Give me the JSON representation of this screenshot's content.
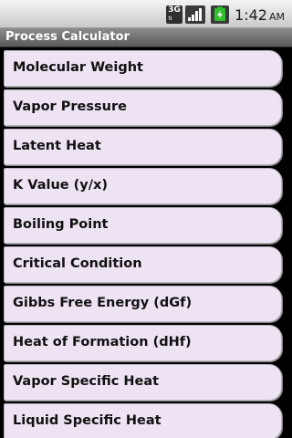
{
  "status_bar": {
    "network_type": "3G",
    "time": "1:42",
    "ampm": "AM",
    "icons": [
      "3g-icon",
      "signal-strength-icon",
      "battery-charging-icon"
    ],
    "battery_color": "#2fbf2f"
  },
  "app": {
    "title": "Process Calculator"
  },
  "menu": {
    "item_background": "#eee3f3",
    "items": [
      {
        "label": "Molecular Weight"
      },
      {
        "label": "Vapor Pressure"
      },
      {
        "label": "Latent Heat"
      },
      {
        "label": "K Value (y/x)"
      },
      {
        "label": "Boiling Point"
      },
      {
        "label": "Critical Condition"
      },
      {
        "label": "Gibbs Free Energy (dGf)"
      },
      {
        "label": "Heat of Formation (dHf)"
      },
      {
        "label": "Vapor Specific Heat"
      },
      {
        "label": "Liquid Specific Heat"
      }
    ]
  }
}
